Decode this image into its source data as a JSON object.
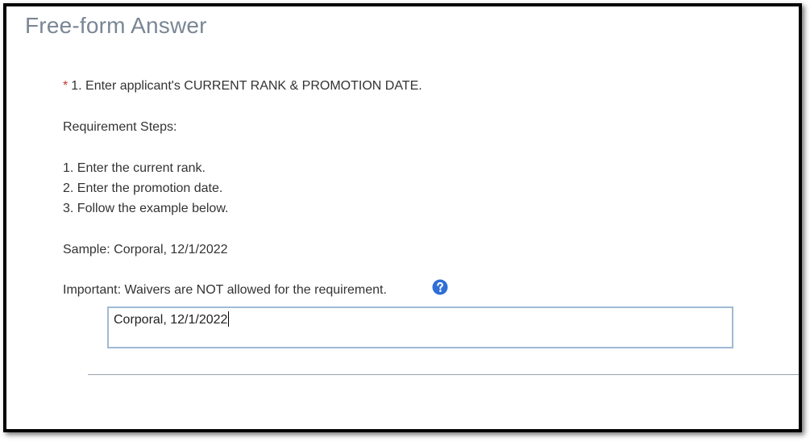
{
  "title": "Free-form Answer",
  "question": {
    "required_marker": "*",
    "text": "1. Enter applicant's CURRENT RANK & PROMOTION DATE."
  },
  "requirement_heading": "Requirement Steps:",
  "steps": [
    "1. Enter the current rank.",
    "2. Enter the promotion date.",
    "3. Follow the example below."
  ],
  "sample": "Sample: Corporal, 12/1/2022",
  "important": "Important: Waivers are NOT allowed for the requirement.",
  "answer": {
    "value": "Corporal, 12/1/2022"
  },
  "colors": {
    "title": "#7a8694",
    "required": "#c0392b",
    "help_icon": "#2f6fd6",
    "input_border": "#9fbad4"
  },
  "icons": {
    "help": "question-circle-icon"
  }
}
